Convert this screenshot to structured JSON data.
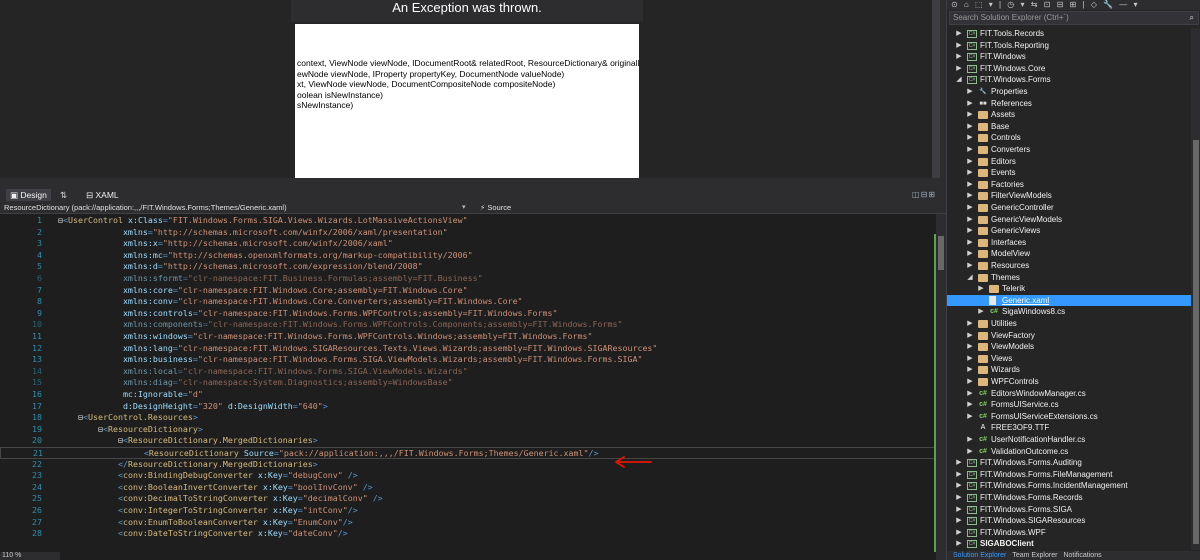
{
  "designer": {
    "exception_title": "An Exception was thrown.",
    "exception_lines": [
      "context, ViewNode viewNode, IDocumentRoot& relatedRoot, ResourceDictionary& originalInstance)",
      "ewNode viewNode, IProperty propertyKey, DocumentNode valueNode)",
      "xt, ViewNode viewNode, DocumentCompositeNode compositeNode)",
      "oolean isNewInstance)",
      "sNewInstance)"
    ]
  },
  "tabs": {
    "design": "Design",
    "swap": "⇅",
    "xaml": "XAML"
  },
  "navbar": {
    "left": "ResourceDictionary (pack://application:,,,/FIT.Windows.Forms;Themes/Generic.xaml)",
    "right_icon": "⚡",
    "right": "Source"
  },
  "editor": {
    "zoom": "110 %",
    "lines": [
      {
        "n": "1",
        "t": [
          [
            "pl",
            "⊟"
          ],
          [
            "tag",
            "<"
          ],
          [
            "el",
            "UserControl "
          ],
          [
            "at",
            "x:Class"
          ],
          [
            "tag",
            "="
          ],
          [
            "st",
            "\"FIT.Windows.Forms.SIGA.Views.Wizards.LotMassiveActionsView\""
          ]
        ]
      },
      {
        "n": "2",
        "t": [
          [
            "pl",
            "             "
          ],
          [
            "at",
            "xmlns"
          ],
          [
            "tag",
            "="
          ],
          [
            "st",
            "\"http://schemas.microsoft.com/winfx/2006/xaml/presentation\""
          ]
        ]
      },
      {
        "n": "3",
        "t": [
          [
            "pl",
            "             "
          ],
          [
            "at",
            "xmlns:x"
          ],
          [
            "tag",
            "="
          ],
          [
            "st",
            "\"http://schemas.microsoft.com/winfx/2006/xaml\""
          ]
        ]
      },
      {
        "n": "4",
        "t": [
          [
            "pl",
            "             "
          ],
          [
            "at",
            "xmlns:mc"
          ],
          [
            "tag",
            "="
          ],
          [
            "st",
            "\"http://schemas.openxmlformats.org/markup-compatibility/2006\""
          ]
        ]
      },
      {
        "n": "5",
        "t": [
          [
            "pl",
            "             "
          ],
          [
            "at",
            "xmlns:d"
          ],
          [
            "tag",
            "="
          ],
          [
            "st",
            "\"http://schemas.microsoft.com/expression/blend/2008\""
          ]
        ]
      },
      {
        "n": "6",
        "dim": true,
        "t": [
          [
            "pl",
            "             "
          ],
          [
            "at",
            "xmlns:sformt"
          ],
          [
            "tag",
            "="
          ],
          [
            "st",
            "\"clr-namespace:FIT.Business.Formulas;assembly=FIT.Business\""
          ]
        ]
      },
      {
        "n": "7",
        "t": [
          [
            "pl",
            "             "
          ],
          [
            "at",
            "xmlns:core"
          ],
          [
            "tag",
            "="
          ],
          [
            "st",
            "\"clr-namespace:FIT.Windows.Core;assembly=FIT.Windows.Core\""
          ]
        ]
      },
      {
        "n": "8",
        "t": [
          [
            "pl",
            "             "
          ],
          [
            "at",
            "xmlns:conv"
          ],
          [
            "tag",
            "="
          ],
          [
            "st",
            "\"clr-namespace:FIT.Windows.Core.Converters;assembly=FIT.Windows.Core\""
          ]
        ]
      },
      {
        "n": "9",
        "t": [
          [
            "pl",
            "             "
          ],
          [
            "at",
            "xmlns:controls"
          ],
          [
            "tag",
            "="
          ],
          [
            "st",
            "\"clr-namespace:FIT.Windows.Forms.WPFControls;assembly=FIT.Windows.Forms\""
          ]
        ]
      },
      {
        "n": "10",
        "dim": true,
        "t": [
          [
            "pl",
            "             "
          ],
          [
            "at",
            "xmlns:components"
          ],
          [
            "tag",
            "="
          ],
          [
            "st",
            "\"clr-namespace:FIT.Windows.Forms.WPFControls.Components;assembly=FIT.Windows.Forms\""
          ]
        ]
      },
      {
        "n": "11",
        "t": [
          [
            "pl",
            "             "
          ],
          [
            "at",
            "xmlns:windows"
          ],
          [
            "tag",
            "="
          ],
          [
            "st",
            "\"clr-namespace:FIT.Windows.Forms.WPFControls.Windows;assembly=FIT.Windows.Forms\""
          ]
        ]
      },
      {
        "n": "12",
        "t": [
          [
            "pl",
            "             "
          ],
          [
            "at",
            "xmlns:lang"
          ],
          [
            "tag",
            "="
          ],
          [
            "st",
            "\"clr-namespace:FIT.Windows.SIGAResources.Texts.Views.Wizards;assembly=FIT.Windows.SIGAResources\""
          ]
        ]
      },
      {
        "n": "13",
        "t": [
          [
            "pl",
            "             "
          ],
          [
            "at",
            "xmlns:business"
          ],
          [
            "tag",
            "="
          ],
          [
            "st",
            "\"clr-namespace:FIT.Windows.Forms.SIGA.ViewModels.Wizards;assembly=FIT.Windows.Forms.SIGA\""
          ]
        ]
      },
      {
        "n": "14",
        "dim": true,
        "t": [
          [
            "pl",
            "             "
          ],
          [
            "at",
            "xmlns:local"
          ],
          [
            "tag",
            "="
          ],
          [
            "st",
            "\"clr-namespace:FIT.Windows.Forms.SIGA.ViewModels.Wizards\""
          ]
        ]
      },
      {
        "n": "15",
        "dim": true,
        "t": [
          [
            "pl",
            "             "
          ],
          [
            "at",
            "xmlns:diag"
          ],
          [
            "tag",
            "="
          ],
          [
            "st",
            "\"clr-namespace:System.Diagnostics;assembly=WindowsBase\""
          ]
        ]
      },
      {
        "n": "16",
        "t": [
          [
            "pl",
            "             "
          ],
          [
            "at",
            "mc:Ignorable"
          ],
          [
            "tag",
            "="
          ],
          [
            "st",
            "\"d\""
          ]
        ]
      },
      {
        "n": "17",
        "t": [
          [
            "pl",
            "             "
          ],
          [
            "at",
            "d:DesignHeight"
          ],
          [
            "tag",
            "="
          ],
          [
            "st",
            "\"320\" "
          ],
          [
            "at",
            "d:DesignWidth"
          ],
          [
            "tag",
            "="
          ],
          [
            "st",
            "\"640\""
          ],
          [
            "tag",
            ">"
          ]
        ]
      },
      {
        "n": "18",
        "t": [
          [
            "pl",
            "    ⊟"
          ],
          [
            "tag",
            "<"
          ],
          [
            "el",
            "UserControl.Resources"
          ],
          [
            "tag",
            ">"
          ]
        ]
      },
      {
        "n": "19",
        "t": [
          [
            "pl",
            "        ⊟"
          ],
          [
            "tag",
            "<"
          ],
          [
            "el",
            "ResourceDictionary"
          ],
          [
            "tag",
            ">"
          ]
        ]
      },
      {
        "n": "20",
        "t": [
          [
            "pl",
            "            ⊟"
          ],
          [
            "tag",
            "<"
          ],
          [
            "el",
            "ResourceDictionary.MergedDictionaries"
          ],
          [
            "tag",
            ">"
          ]
        ]
      },
      {
        "n": "21",
        "cur": true,
        "t": [
          [
            "pl",
            "                 "
          ],
          [
            "tag",
            "<"
          ],
          [
            "el",
            "ResourceDictionary "
          ],
          [
            "at",
            "Source"
          ],
          [
            "tag",
            "="
          ],
          [
            "st",
            "\"pack://application:,,,/FIT.Windows.Forms;Themes/Generic.xaml\""
          ],
          [
            "tag",
            "/>"
          ]
        ]
      },
      {
        "n": "22",
        "t": [
          [
            "pl",
            "            "
          ],
          [
            "tag",
            "</"
          ],
          [
            "el",
            "ResourceDictionary.MergedDictionaries"
          ],
          [
            "tag",
            ">"
          ]
        ]
      },
      {
        "n": "23",
        "t": [
          [
            "pl",
            "            "
          ],
          [
            "tag",
            "<"
          ],
          [
            "el",
            "conv:BindingDebugConverter "
          ],
          [
            "at",
            "x:Key"
          ],
          [
            "tag",
            "="
          ],
          [
            "st",
            "\"debugConv\" "
          ],
          [
            "tag",
            "/>"
          ]
        ]
      },
      {
        "n": "24",
        "t": [
          [
            "pl",
            "            "
          ],
          [
            "tag",
            "<"
          ],
          [
            "el",
            "conv:BooleanInvertConverter "
          ],
          [
            "at",
            "x:Key"
          ],
          [
            "tag",
            "="
          ],
          [
            "st",
            "\"boolInvConv\" "
          ],
          [
            "tag",
            "/>"
          ]
        ]
      },
      {
        "n": "25",
        "t": [
          [
            "pl",
            "            "
          ],
          [
            "tag",
            "<"
          ],
          [
            "el",
            "conv:DecimalToStringConverter "
          ],
          [
            "at",
            "x:Key"
          ],
          [
            "tag",
            "="
          ],
          [
            "st",
            "\"decimalConv\" "
          ],
          [
            "tag",
            "/>"
          ]
        ]
      },
      {
        "n": "26",
        "t": [
          [
            "pl",
            "            "
          ],
          [
            "tag",
            "<"
          ],
          [
            "el",
            "conv:IntegerToStringConverter "
          ],
          [
            "at",
            "x:Key"
          ],
          [
            "tag",
            "="
          ],
          [
            "st",
            "\"intConv\""
          ],
          [
            "tag",
            "/>"
          ]
        ]
      },
      {
        "n": "27",
        "t": [
          [
            "pl",
            "            "
          ],
          [
            "tag",
            "<"
          ],
          [
            "el",
            "conv:EnumToBooleanConverter "
          ],
          [
            "at",
            "x:Key"
          ],
          [
            "tag",
            "="
          ],
          [
            "st",
            "\"EnumConv\""
          ],
          [
            "tag",
            "/>"
          ]
        ]
      },
      {
        "n": "28",
        "t": [
          [
            "pl",
            "            "
          ],
          [
            "tag",
            "<"
          ],
          [
            "el",
            "conv:DateToStringConverter "
          ],
          [
            "at",
            "x:Key"
          ],
          [
            "tag",
            "="
          ],
          [
            "st",
            "\"dateConv\""
          ],
          [
            "tag",
            "/>"
          ]
        ]
      }
    ]
  },
  "solution_explorer": {
    "toolbar": "⊙ ⌂ ⬚ ▾ | ◷ ▾ ⇆ ⊡ ⊟ ⊞ | ◇ 🔧 — ▾",
    "search_placeholder": "Search Solution Explorer (Ctrl+´)",
    "search_icon": "⌕",
    "tabs": [
      "Solution Explorer",
      "Team Explorer",
      "Notifications"
    ],
    "nodes": [
      {
        "name": "FIT.Tools.Records",
        "icon": "proj",
        "depth": 0,
        "arrow": "▶"
      },
      {
        "name": "FIT.Tools.Reporting",
        "icon": "proj",
        "depth": 0,
        "arrow": "▶"
      },
      {
        "name": "FIT.Windows",
        "icon": "proj",
        "depth": 0,
        "arrow": "▶"
      },
      {
        "name": "FIT.Windows.Core",
        "icon": "proj",
        "depth": 0,
        "arrow": "▶"
      },
      {
        "name": "FIT.Windows.Forms",
        "icon": "proj",
        "depth": 0,
        "arrow": "◢"
      },
      {
        "name": "Properties",
        "icon": "prop",
        "depth": 1,
        "arrow": "▶"
      },
      {
        "name": "References",
        "icon": "ref",
        "depth": 1,
        "arrow": "▶"
      },
      {
        "name": "Assets",
        "icon": "folder",
        "depth": 1,
        "arrow": "▶"
      },
      {
        "name": "Base",
        "icon": "folder",
        "depth": 1,
        "arrow": "▶"
      },
      {
        "name": "Controls",
        "icon": "folder",
        "depth": 1,
        "arrow": "▶"
      },
      {
        "name": "Converters",
        "icon": "folder",
        "depth": 1,
        "arrow": "▶"
      },
      {
        "name": "Editors",
        "icon": "folder",
        "depth": 1,
        "arrow": "▶"
      },
      {
        "name": "Events",
        "icon": "folder",
        "depth": 1,
        "arrow": "▶"
      },
      {
        "name": "Factories",
        "icon": "folder",
        "depth": 1,
        "arrow": "▶"
      },
      {
        "name": "FilterViewModels",
        "icon": "folder",
        "depth": 1,
        "arrow": "▶"
      },
      {
        "name": "GenericController",
        "icon": "folder",
        "depth": 1,
        "arrow": "▶"
      },
      {
        "name": "GenericViewModels",
        "icon": "folder",
        "depth": 1,
        "arrow": "▶"
      },
      {
        "name": "GenericViews",
        "icon": "folder",
        "depth": 1,
        "arrow": "▶"
      },
      {
        "name": "Interfaces",
        "icon": "folder",
        "depth": 1,
        "arrow": "▶"
      },
      {
        "name": "ModelView",
        "icon": "folder",
        "depth": 1,
        "arrow": "▶"
      },
      {
        "name": "Resources",
        "icon": "folder",
        "depth": 1,
        "arrow": "▶"
      },
      {
        "name": "Themes",
        "icon": "folder",
        "depth": 1,
        "arrow": "◢"
      },
      {
        "name": "Telerik",
        "icon": "folder",
        "depth": 2,
        "arrow": "▶"
      },
      {
        "name": "Generic.xaml",
        "icon": "file",
        "depth": 2,
        "arrow": "",
        "sel": true
      },
      {
        "name": "SigaWindows8.cs",
        "icon": "cs",
        "depth": 2,
        "arrow": "▶"
      },
      {
        "name": "Utilities",
        "icon": "folder",
        "depth": 1,
        "arrow": "▶"
      },
      {
        "name": "ViewFactory",
        "icon": "folder",
        "depth": 1,
        "arrow": "▶"
      },
      {
        "name": "ViewModels",
        "icon": "folder",
        "depth": 1,
        "arrow": "▶"
      },
      {
        "name": "Views",
        "icon": "folder",
        "depth": 1,
        "arrow": "▶"
      },
      {
        "name": "Wizards",
        "icon": "folder",
        "depth": 1,
        "arrow": "▶"
      },
      {
        "name": "WPFControls",
        "icon": "folder",
        "depth": 1,
        "arrow": "▶"
      },
      {
        "name": "EditorsWindowManager.cs",
        "icon": "cs",
        "depth": 1,
        "arrow": "▶"
      },
      {
        "name": "FormsUIService.cs",
        "icon": "cs",
        "depth": 1,
        "arrow": "▶"
      },
      {
        "name": "FormsUIServiceExtensions.cs",
        "icon": "cs",
        "depth": 1,
        "arrow": "▶"
      },
      {
        "name": "FREE3OF9.TTF",
        "icon": "font",
        "depth": 1,
        "arrow": ""
      },
      {
        "name": "UserNotificationHandler.cs",
        "icon": "cs",
        "depth": 1,
        "arrow": "▶"
      },
      {
        "name": "ValidationOutcome.cs",
        "icon": "cs",
        "depth": 1,
        "arrow": "▶"
      },
      {
        "name": "FIT.Windows.Forms.Auditing",
        "icon": "proj",
        "depth": 0,
        "arrow": "▶"
      },
      {
        "name": "FIT.Windows.Forms.FileManagement",
        "icon": "proj",
        "depth": 0,
        "arrow": "▶"
      },
      {
        "name": "FIT.Windows.Forms.IncidentManagement",
        "icon": "proj",
        "depth": 0,
        "arrow": "▶"
      },
      {
        "name": "FIT.Windows.Forms.Records",
        "icon": "proj",
        "depth": 0,
        "arrow": "▶"
      },
      {
        "name": "FIT.Windows.Forms.SIGA",
        "icon": "proj",
        "depth": 0,
        "arrow": "▶"
      },
      {
        "name": "FIT.Windows.SIGAResources",
        "icon": "proj",
        "depth": 0,
        "arrow": "▶"
      },
      {
        "name": "FIT.Windows.WPF",
        "icon": "proj",
        "depth": 0,
        "arrow": "▶"
      },
      {
        "name": "SIGABOClient",
        "icon": "proj",
        "depth": 0,
        "arrow": "▶",
        "bold": true
      }
    ]
  },
  "colors": {
    "accent": "#3399ff",
    "arrow": "#e51400",
    "change_bar": "#57a64a"
  }
}
